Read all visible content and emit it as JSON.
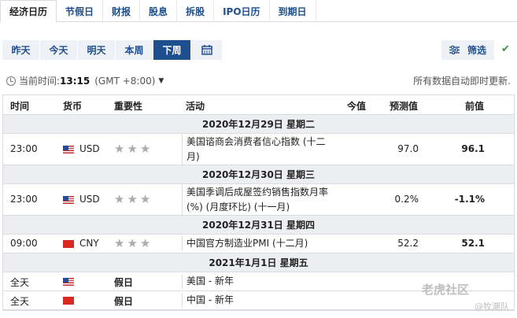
{
  "tabs": [
    {
      "label": "经济日历",
      "active": true
    },
    {
      "label": "节假日",
      "active": false
    },
    {
      "label": "财报",
      "active": false
    },
    {
      "label": "股息",
      "active": false
    },
    {
      "label": "拆股",
      "active": false
    },
    {
      "label": "IPO日历",
      "active": false
    },
    {
      "label": "到期日",
      "active": false
    }
  ],
  "day_buttons": [
    {
      "label": "昨天"
    },
    {
      "label": "今天"
    },
    {
      "label": "明天"
    },
    {
      "label": "本周"
    },
    {
      "label": "下周",
      "active": true
    }
  ],
  "filter": {
    "label": "筛选"
  },
  "time_bar": {
    "prefix": "当前时间:",
    "time": "13:15",
    "timezone": "(GMT +8:00)",
    "auto_update": "所有数据自动即时更新."
  },
  "columns": {
    "time": "时间",
    "currency": "货币",
    "importance": "重要性",
    "event": "活动",
    "actual": "今值",
    "forecast": "预测值",
    "previous": "前值"
  },
  "days": [
    {
      "date": "2020年12月29日  星期二",
      "events": [
        {
          "time": "23:00",
          "flag": "us",
          "currency": "USD",
          "event": "美国谘商会消费者信心指数 (十二月)",
          "actual": "",
          "forecast": "97.0",
          "previous": "96.1"
        }
      ]
    },
    {
      "date": "2020年12月30日  星期三",
      "events": [
        {
          "time": "23:00",
          "flag": "us",
          "currency": "USD",
          "event": "美国季调后成屋签约销售指数月率(%) (月度环比) (十一月)",
          "actual": "",
          "forecast": "0.2%",
          "previous": "-1.1%"
        }
      ]
    },
    {
      "date": "2020年12月31日  星期四",
      "events": [
        {
          "time": "09:00",
          "flag": "cn",
          "currency": "CNY",
          "event": "中国官方制造业PMI (十二月)",
          "actual": "",
          "forecast": "52.2",
          "previous": "52.1"
        }
      ]
    },
    {
      "date": "2021年1月1日  星期五",
      "events": [
        {
          "time": "全天",
          "flag": "us",
          "holiday": "假日",
          "event": "美国 - 新年"
        },
        {
          "time": "全天",
          "flag": "cn",
          "holiday": "假日",
          "event": "中国 - 新年"
        }
      ]
    }
  ],
  "watermark": {
    "main": "老虎社区",
    "sub": "@牧潮队"
  }
}
